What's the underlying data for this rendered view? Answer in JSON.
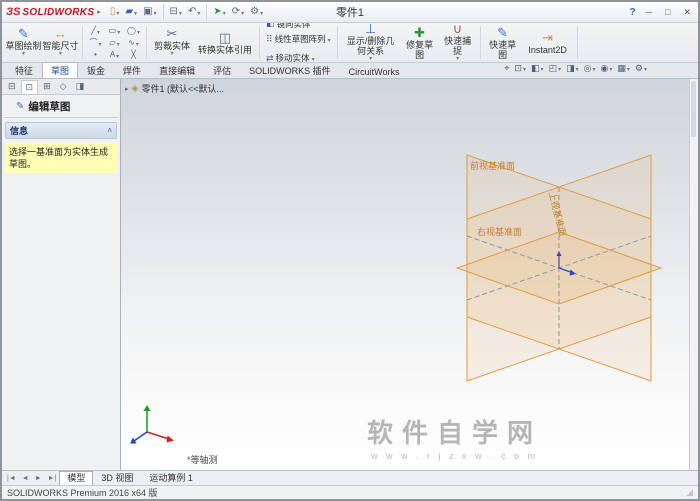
{
  "titlebar": {
    "logo_mark": "ЗS",
    "logo_name": "SOLIDWORKS",
    "logo_arrow": "▸",
    "doc_title": "零件1",
    "icons": [
      {
        "name": "new",
        "glyph": "▯"
      },
      {
        "name": "open",
        "glyph": "▰"
      },
      {
        "name": "save",
        "glyph": "▣"
      },
      {
        "name": "print",
        "glyph": "⊟"
      },
      {
        "name": "undo",
        "glyph": "↶"
      },
      {
        "name": "select",
        "glyph": "➤"
      },
      {
        "name": "rebuild",
        "glyph": "⟳"
      },
      {
        "name": "options",
        "glyph": "⚙"
      }
    ],
    "help_glyph": "?",
    "win": {
      "min": "─",
      "max": "□",
      "close": "✕"
    }
  },
  "ribbon": {
    "large": [
      {
        "label": "草图绘制",
        "glyph": "✎"
      },
      {
        "label": "智能尺寸",
        "glyph": "↔"
      }
    ],
    "grid": [
      {
        "name": "line",
        "glyph": "╱"
      },
      {
        "name": "rectangle",
        "glyph": "▭"
      },
      {
        "name": "circle",
        "glyph": "◯"
      },
      {
        "name": "arc",
        "glyph": "⌒"
      },
      {
        "name": "polygon",
        "glyph": "▱"
      },
      {
        "name": "spline",
        "glyph": "∿"
      },
      {
        "name": "point",
        "glyph": "•"
      },
      {
        "name": "text",
        "glyph": "A"
      },
      {
        "name": "erase",
        "glyph": "╳"
      }
    ],
    "medium": [
      {
        "label": "剪裁实体",
        "glyph": "✂"
      },
      {
        "label": "转换实体引用",
        "glyph": "◫"
      }
    ],
    "rows": [
      {
        "label": "镜向实体",
        "glyph": "◧"
      },
      {
        "label": "线性草图阵列",
        "glyph": "⠿"
      },
      {
        "label": "移动实体",
        "glyph": "⇄"
      }
    ],
    "right": [
      {
        "label": "显示/删除几何关系",
        "glyph": "⊥"
      },
      {
        "label": "修复草图",
        "glyph": "✚"
      },
      {
        "label": "快速捕捉",
        "glyph": "∪"
      },
      {
        "label": "快速草图",
        "glyph": "✎"
      },
      {
        "label": "Instant2D",
        "glyph": "⇥"
      }
    ]
  },
  "tabs": {
    "items": [
      {
        "label": "特征"
      },
      {
        "label": "草图"
      },
      {
        "label": "钣金"
      },
      {
        "label": "焊件"
      },
      {
        "label": "直接编辑"
      },
      {
        "label": "评估"
      },
      {
        "label": "SOLIDWORKS 插件"
      },
      {
        "label": "CircuitWorks"
      }
    ]
  },
  "headsup": {
    "icons": [
      {
        "name": "zoom-fit",
        "glyph": "⌖"
      },
      {
        "name": "zoom-area",
        "glyph": "⊡"
      },
      {
        "name": "section-view",
        "glyph": "◧"
      },
      {
        "name": "view-orientation",
        "glyph": "◰"
      },
      {
        "name": "display-style",
        "glyph": "◨"
      },
      {
        "name": "hide-show-items",
        "glyph": "◎"
      },
      {
        "name": "edit-appearance",
        "glyph": "◉"
      },
      {
        "name": "apply-scene",
        "glyph": "▦"
      },
      {
        "name": "view-settings",
        "glyph": "⚙"
      }
    ]
  },
  "panel": {
    "tabs": [
      {
        "name": "featuremanager",
        "glyph": "⊟"
      },
      {
        "name": "propertymanager",
        "glyph": "⊡"
      },
      {
        "name": "configurationmanager",
        "glyph": "⊞"
      },
      {
        "name": "dimxpertmanager",
        "glyph": "◇"
      },
      {
        "name": "displaymanager",
        "glyph": "◨"
      }
    ],
    "title": "编辑草图",
    "title_glyph": "✎",
    "message": {
      "header": "信息",
      "collapse": "˄",
      "text": "选择一基准面为实体生成草图。"
    }
  },
  "graphics": {
    "tree": {
      "expander": "▸",
      "icon": "◈",
      "label": "零件1 (默认<<默认..."
    },
    "planes": {
      "front": "前视基准面",
      "top": "上视基准面",
      "right": "右视基准面"
    },
    "view_name": "*等轴测",
    "watermark": {
      "line1": "软件自学网",
      "line2": "w w w . r j z x w . c o m"
    },
    "colors": {
      "plane_stroke": "#e09a40",
      "plane_fill": "#f0a84d",
      "origin_blue": "#2a46d4",
      "label_orange": "#c97f2d"
    }
  },
  "bottom": {
    "nav": [
      {
        "name": "scroll-first",
        "glyph": "|◄"
      },
      {
        "name": "scroll-prev",
        "glyph": "◄"
      },
      {
        "name": "scroll-next",
        "glyph": "►"
      },
      {
        "name": "scroll-last",
        "glyph": "►|"
      }
    ],
    "tabs": [
      {
        "label": "模型"
      },
      {
        "label": "3D 视图"
      },
      {
        "label": "运动算例 1"
      }
    ]
  },
  "status": {
    "left": "SOLIDWORKS Premium 2016 x64 版"
  }
}
